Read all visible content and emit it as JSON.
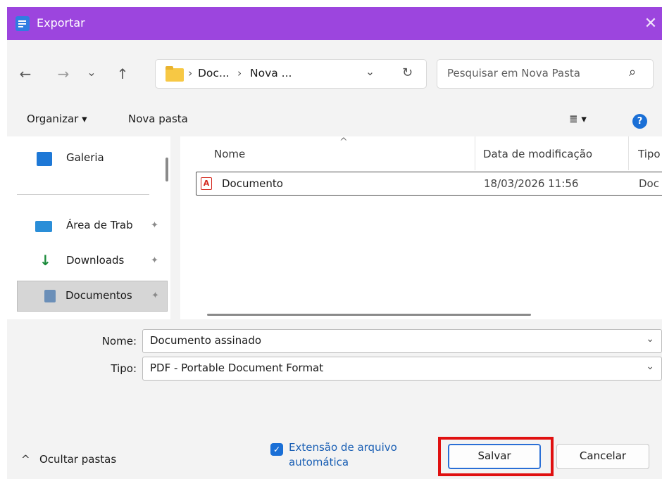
{
  "window": {
    "title": "Exportar",
    "close_glyph": "✕",
    "accent_color": "#9c45de"
  },
  "nav": {
    "back_glyph": "←",
    "forward_glyph": "→",
    "recent_glyph": "⌄",
    "up_glyph": "↑",
    "breadcrumb": [
      "Doc...",
      "Nova ..."
    ],
    "breadcrumb_sep": "›",
    "dropdown_glyph": "⌄",
    "refresh_glyph": "↻",
    "search_placeholder": "Pesquisar em Nova Pasta",
    "search_glyph": "⌕"
  },
  "toolbar": {
    "organize_label": "Organizar ▾",
    "new_folder_label": "Nova pasta",
    "view_glyph": "≣ ▾",
    "help_glyph": "?"
  },
  "sidebar": {
    "items": [
      {
        "label": "Galeria",
        "icon": "gallery-icon",
        "pinned": false
      },
      {
        "label": "Área de Trab",
        "icon": "desktop-icon",
        "pinned": true
      },
      {
        "label": "Downloads",
        "icon": "download-icon",
        "pinned": true
      },
      {
        "label": "Documentos",
        "icon": "documents-icon",
        "pinned": true,
        "selected": true
      }
    ],
    "pin_glyph": "✦"
  },
  "file_list": {
    "sort_glyph": "^",
    "columns": [
      "Nome",
      "Data de modificação",
      "Tipo"
    ],
    "rows": [
      {
        "name": "Documento",
        "modified": "18/03/2026 11:56",
        "type": "Doc"
      }
    ]
  },
  "form": {
    "name_label": "Nome:",
    "name_value": "Documento assinado",
    "type_label": "Tipo:",
    "type_value": "PDF - Portable Document Format",
    "chevron": "⌄"
  },
  "footer": {
    "hide_folders_label": "Ocultar pastas",
    "hide_folders_glyph": "^",
    "auto_ext_checked": true,
    "auto_ext_label": "Extensão de arquivo automática",
    "check_glyph": "✓",
    "save_label": "Salvar",
    "cancel_label": "Cancelar",
    "highlight_color": "#e01010"
  }
}
